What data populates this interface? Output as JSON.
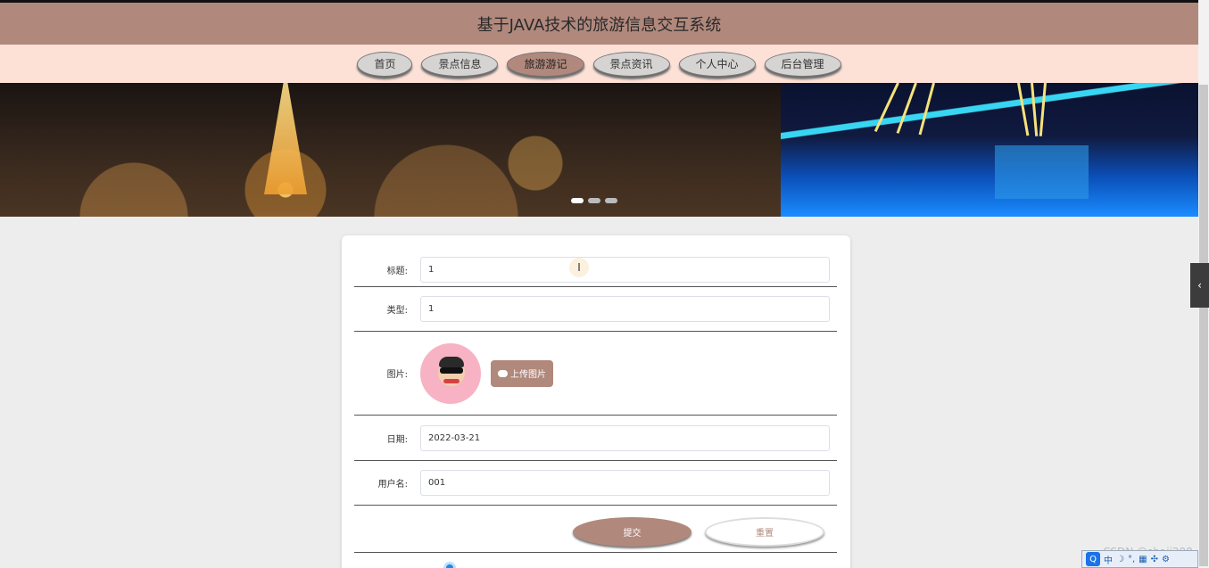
{
  "header": {
    "title": "基于JAVA技术的旅游信息交互系统"
  },
  "nav": {
    "items": [
      {
        "label": "首页"
      },
      {
        "label": "景点信息"
      },
      {
        "label": "旅游游记"
      },
      {
        "label": "景点资讯"
      },
      {
        "label": "个人中心"
      },
      {
        "label": "后台管理"
      }
    ],
    "active_index": 2
  },
  "banner": {
    "slide_count": 3,
    "active_slide": 0
  },
  "form": {
    "title_label": "标题:",
    "title_value": "1",
    "type_label": "类型:",
    "type_value": "1",
    "image_label": "图片:",
    "upload_label": "上传图片",
    "date_label": "日期:",
    "date_value": "2022-03-21",
    "username_label": "用户名:",
    "username_value": "001",
    "submit_label": "提交",
    "reset_label": "重置"
  },
  "watermark": "CSDN @shaji298",
  "tray": {
    "q": "Q",
    "items": [
      "中",
      "☽",
      "°,",
      "▦",
      "✣",
      "⚙"
    ]
  },
  "colors": {
    "accent": "#b1887c",
    "nav_bg": "#fde0d6",
    "header_bg": "#b1887c"
  },
  "icons": [
    "upload-cloud-icon",
    "chevron-left-icon",
    "text-cursor-icon"
  ]
}
